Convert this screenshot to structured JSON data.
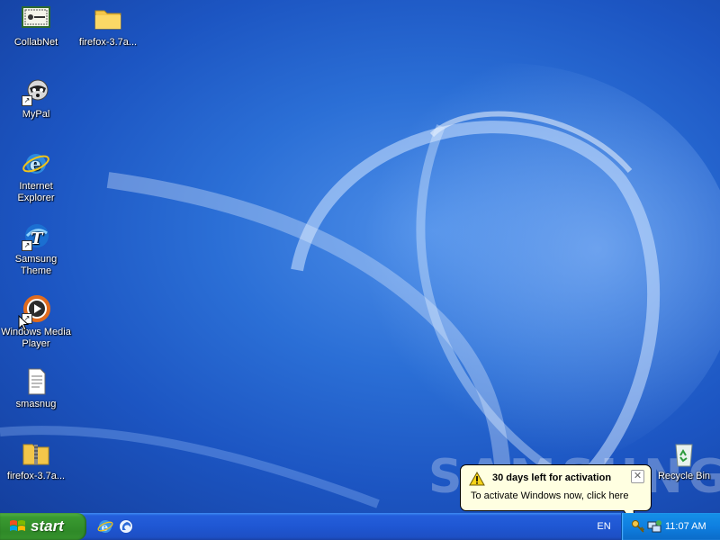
{
  "desktop": {
    "watermark": "SAMSUNG",
    "icons": [
      {
        "label": "CollabNet",
        "icon": "collabnet-app-icon"
      },
      {
        "label": "firefox-3.7a...",
        "icon": "folder-icon"
      },
      {
        "label": "MyPal",
        "icon": "mypal-raccoon-icon"
      },
      {
        "label": "Internet Explorer",
        "icon": "internet-explorer-icon"
      },
      {
        "label": "Samsung Theme",
        "icon": "samsung-theme-icon"
      },
      {
        "label": "Windows Media Player",
        "icon": "windows-media-player-icon"
      },
      {
        "label": "smasnug",
        "icon": "text-document-icon"
      },
      {
        "label": "firefox-3.7a...",
        "icon": "zip-folder-icon"
      },
      {
        "label": "Recycle Bin",
        "icon": "recycle-bin-icon"
      }
    ]
  },
  "taskbar": {
    "start_label": "start",
    "quick_launch": [
      "internet-explorer-icon",
      "firefox-icon"
    ],
    "language": "EN",
    "clock": "11:07 AM",
    "tray_icons": [
      "activation-key-icon",
      "network-icon"
    ]
  },
  "balloon": {
    "title": "30 days left for activation",
    "message": "To activate Windows now, click here",
    "icon": "warning-icon"
  },
  "colors": {
    "taskbar_blue": "#245edb",
    "start_green": "#3a9a31",
    "tray_blue": "#0f7fe0",
    "balloon_bg": "#ffffe1"
  }
}
